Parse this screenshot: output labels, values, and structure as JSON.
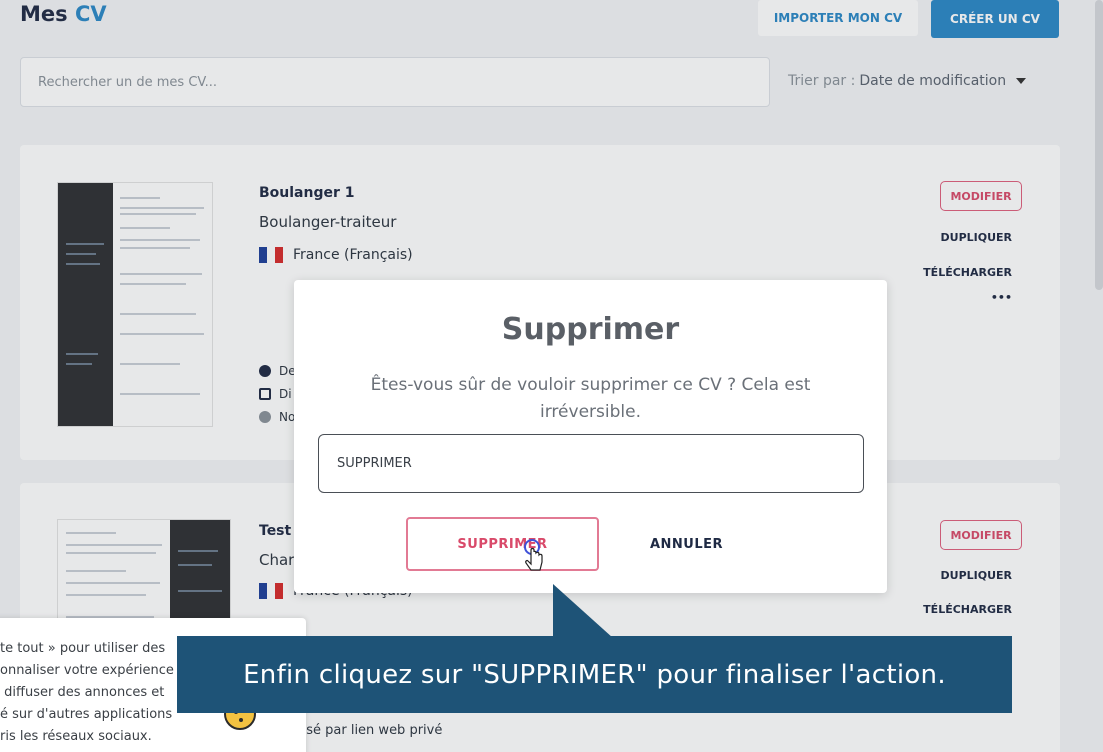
{
  "header": {
    "title_prefix": "Mes",
    "title_accent": "CV",
    "import_label": "IMPORTER MON CV",
    "create_label": "CRÉER UN CV"
  },
  "search": {
    "placeholder": "Rechercher un de mes CV..."
  },
  "sort": {
    "label": "Trier par :",
    "value": "Date de modification"
  },
  "cvs": [
    {
      "title": "Boulanger 1",
      "job": "Boulanger-traiteur",
      "language": "France (Français)",
      "meta": [
        "De",
        "Di",
        "No"
      ],
      "actions": {
        "modify": "MODIFIER",
        "duplicate": "DUPLIQUER",
        "download": "TÉLÉCHARGER",
        "more": "•••"
      }
    },
    {
      "title": "Test",
      "job": "Char",
      "language": "France (Français)",
      "meta_share": "usé par lien web privé",
      "actions": {
        "modify": "MODIFIER",
        "duplicate": "DUPLIQUER",
        "download": "TÉLÉCHARGER"
      }
    }
  ],
  "modal": {
    "title": "Supprimer",
    "message": "Êtes-vous sûr de vouloir supprimer ce CV ? Cela est irréversible.",
    "input_value": "SUPPRIMER",
    "confirm_label": "SUPPRIMER",
    "cancel_label": "ANNULER"
  },
  "caption": "Enfin cliquez sur \"SUPPRIMER\" pour finaliser l'action.",
  "cookie": {
    "text": "te tout » pour utiliser des\nonnaliser votre expérience\n diffuser des annonces et\né sur d'autres applications\nris les réseaux sociaux."
  },
  "colors": {
    "accent": "#2b88c6",
    "danger": "#d94a6a",
    "navy": "#1f2a44",
    "caption_bg": "#1e5377"
  }
}
